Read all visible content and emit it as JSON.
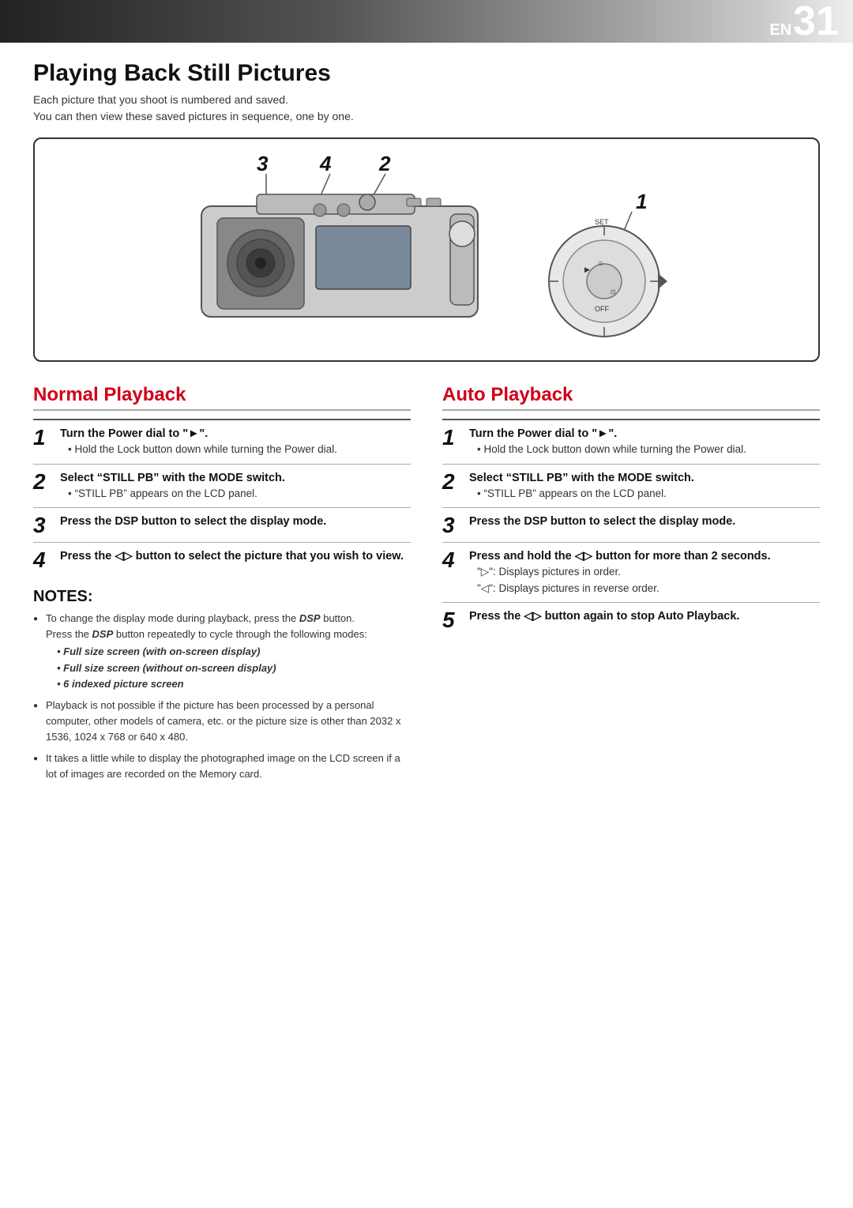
{
  "header": {
    "en_label": "EN",
    "page_number": "31"
  },
  "page_title": "Playing Back Still Pictures",
  "intro_lines": [
    "Each picture that you shoot is numbered and saved.",
    "You can then view these saved pictures in sequence, one by one."
  ],
  "diagram_numbers": [
    "3",
    "4",
    "2",
    "1"
  ],
  "normal_playback": {
    "heading": "Normal Playback",
    "steps": [
      {
        "num": "1",
        "main": "Turn the Power dial to \"►\".",
        "sub": [
          "Hold the Lock button down while turning the Power dial."
        ]
      },
      {
        "num": "2",
        "main": "Select “STILL PB” with the MODE switch.",
        "sub": [
          "“STILL PB” appears on the LCD panel."
        ]
      },
      {
        "num": "3",
        "main": "Press the DSP button to select the display mode.",
        "sub": []
      },
      {
        "num": "4",
        "main": "Press the ◁▷ button to select the picture that you wish to view.",
        "sub": []
      }
    ],
    "notes_title": "NOTES:",
    "notes": [
      {
        "text": "To change the display mode during playback, press the DSP button.\nPress the DSP button repeatedly to cycle through the following modes:",
        "bold_italic_part": "DSP",
        "sub_bullets": [
          "Full size screen (with on-screen display)",
          "Full size screen (without on-screen display)",
          "6 indexed picture screen"
        ]
      },
      {
        "text": "Playback is not possible if the picture has been processed by a personal computer, other models of camera, etc. or the picture size is other than 2032 x 1536, 1024 x 768 or 640 x 480.",
        "sub_bullets": []
      },
      {
        "text": "It takes a little while to display the photographed image on the LCD screen if a lot of images are recorded on the Memory card.",
        "sub_bullets": []
      }
    ]
  },
  "auto_playback": {
    "heading": "Auto Playback",
    "steps": [
      {
        "num": "1",
        "main": "Turn the Power dial to \"►\".",
        "sub": [
          "Hold the Lock button down while turning the Power dial."
        ]
      },
      {
        "num": "2",
        "main": "Select “STILL PB” with the MODE switch.",
        "sub": [
          "“STILL PB” appears on the LCD panel."
        ]
      },
      {
        "num": "3",
        "main": "Press the DSP button to select the display mode.",
        "sub": []
      },
      {
        "num": "4",
        "main": "Press and hold the ◁▷ button for more than 2 seconds.",
        "sub": [
          "\"▷\": Displays pictures in order.",
          "\"◁\": Displays pictures in reverse order."
        ]
      },
      {
        "num": "5",
        "main": "Press the ◁▷ button again to stop Auto Playback.",
        "sub": []
      }
    ]
  }
}
